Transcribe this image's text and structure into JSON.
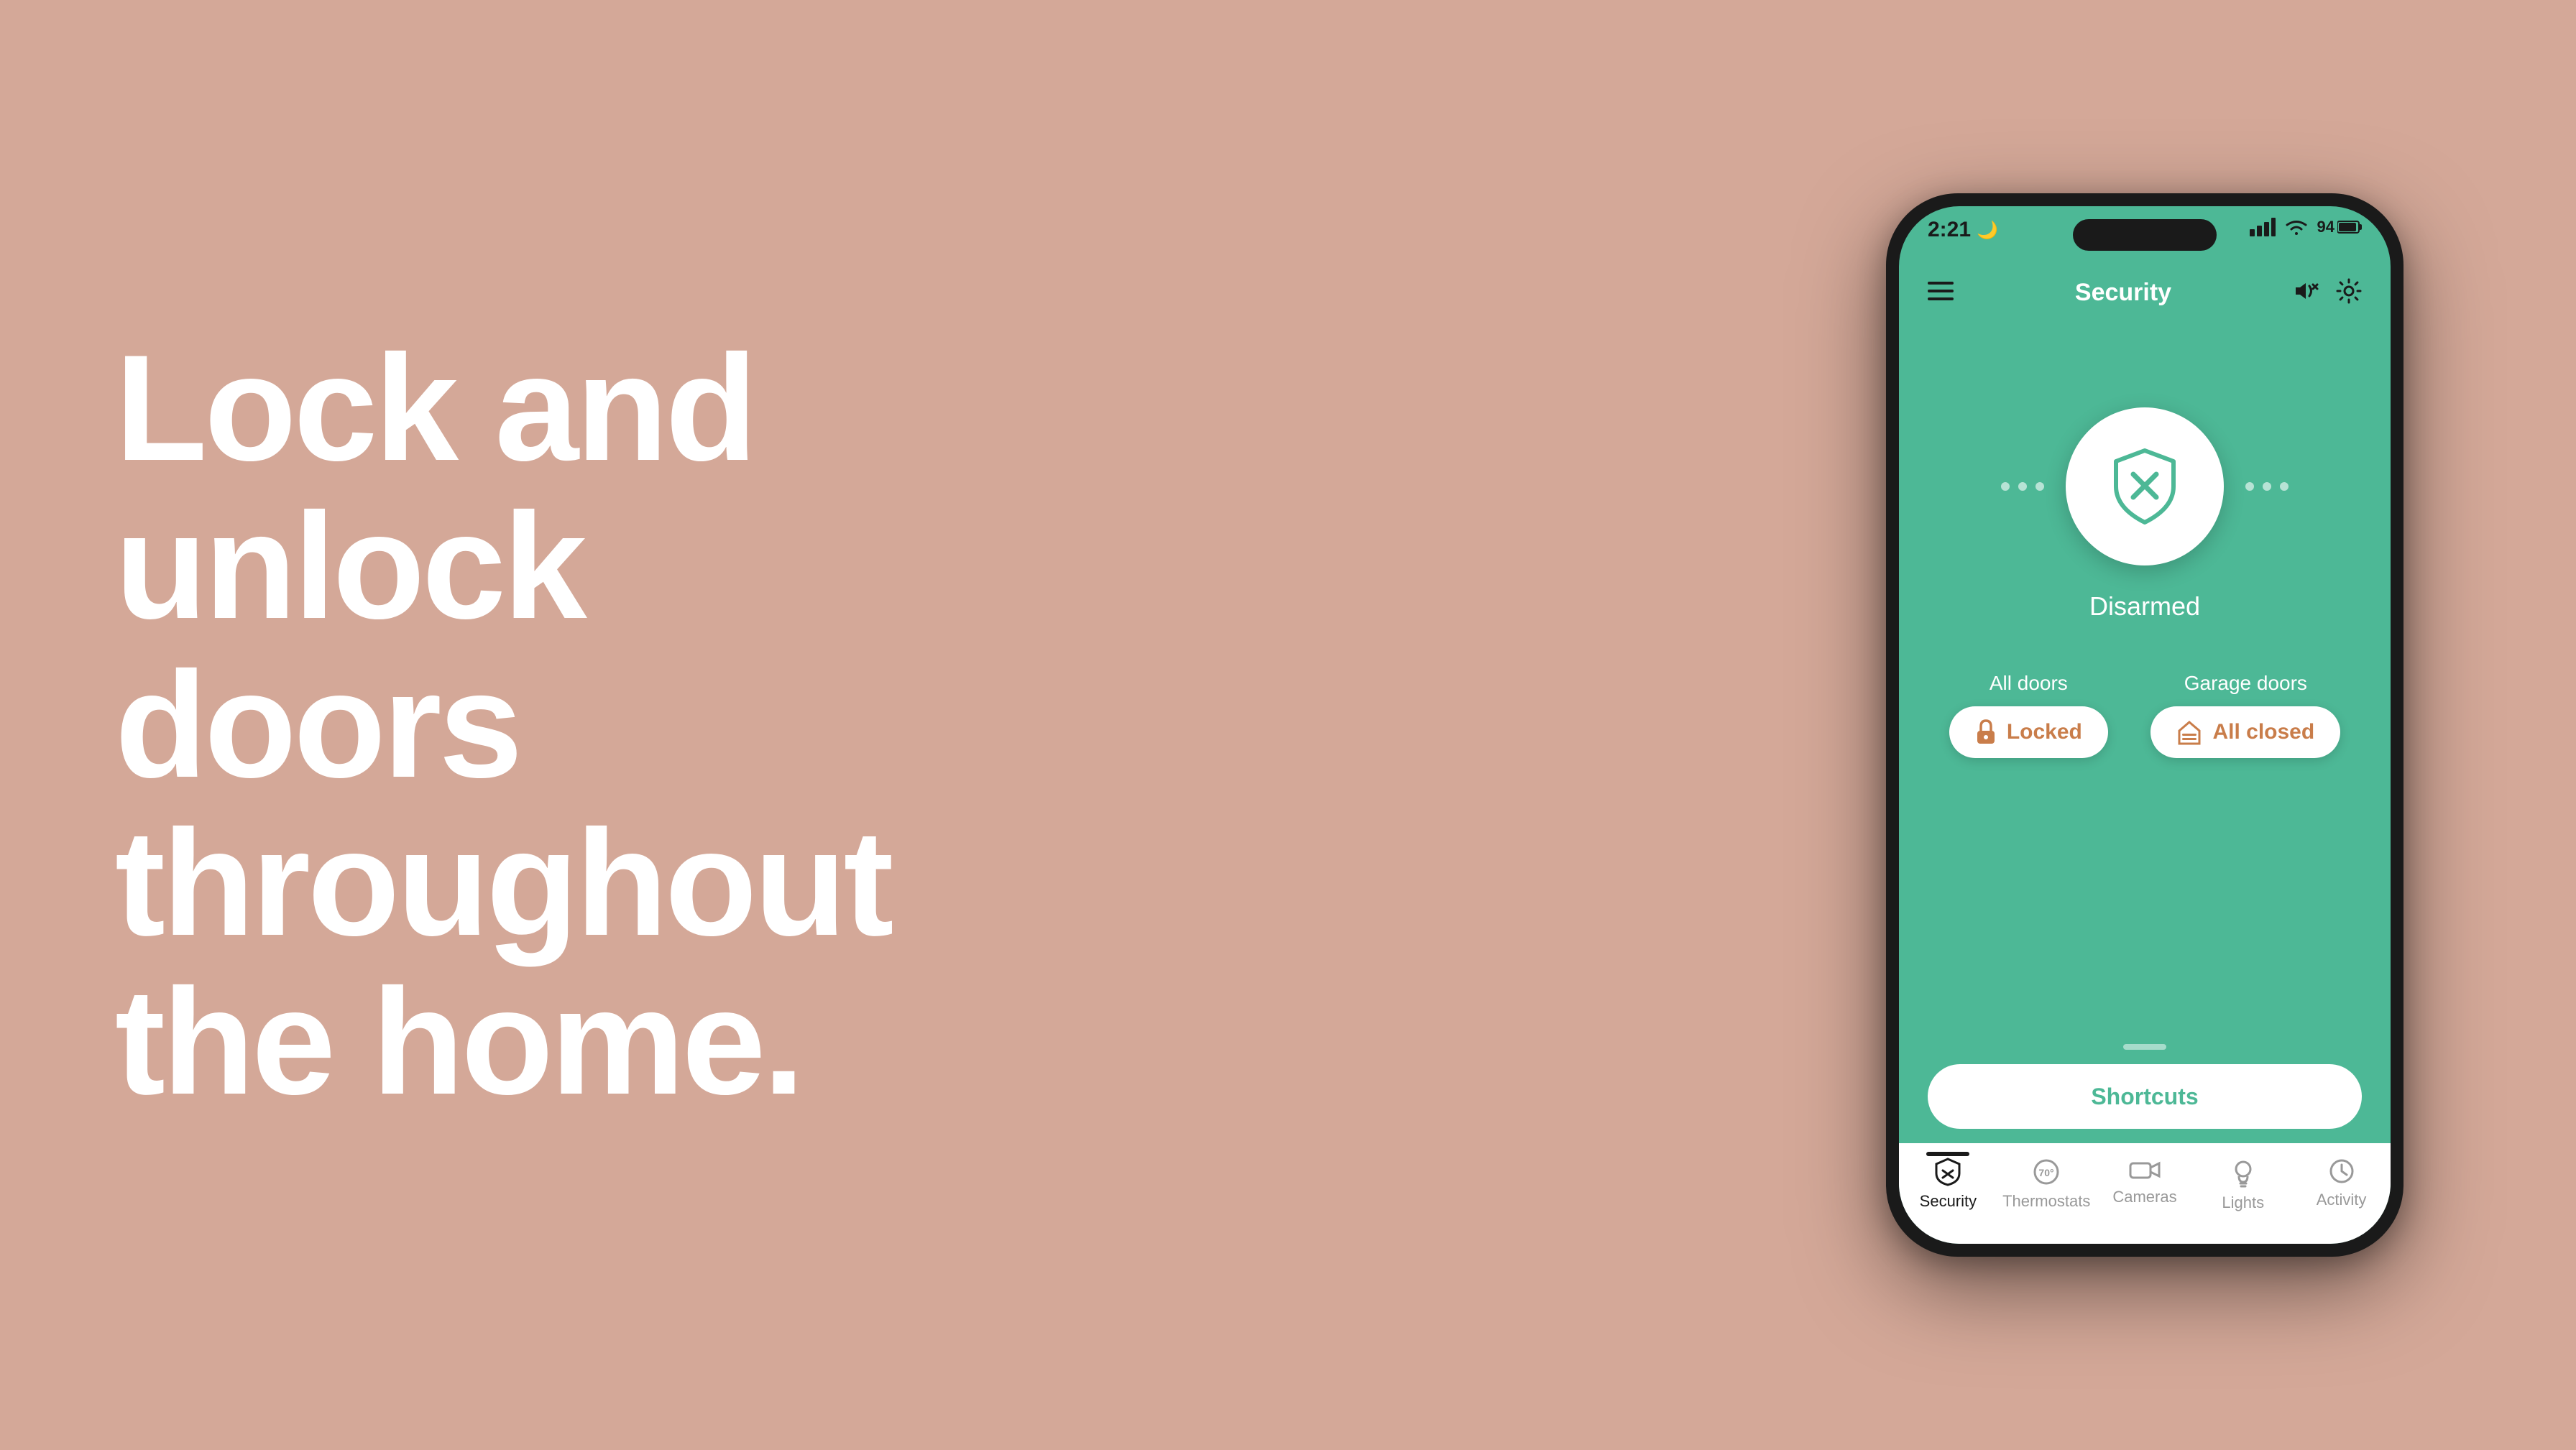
{
  "background": {
    "color": "#d4a898"
  },
  "headline": {
    "line1": "Lock and",
    "line2": "unlock",
    "line3": "doors",
    "line4": "throughout",
    "line5": "the home."
  },
  "status_bar": {
    "time": "2:21",
    "moon_symbol": "☽",
    "battery_percent": "94"
  },
  "app_header": {
    "menu_icon": "≡",
    "title": "Security",
    "volume_icon": "🔊",
    "settings_icon": "⚙"
  },
  "security": {
    "status": "Disarmed",
    "dots_left": [
      "•",
      "•",
      "•"
    ],
    "dots_right": [
      "•",
      "•",
      "•"
    ]
  },
  "doors": {
    "all_doors": {
      "label": "All doors",
      "status": "Locked"
    },
    "garage_doors": {
      "label": "Garage doors",
      "status": "All closed"
    }
  },
  "shortcuts": {
    "label": "Shortcuts"
  },
  "bottom_nav": {
    "items": [
      {
        "id": "security",
        "label": "Security",
        "active": true
      },
      {
        "id": "thermostats",
        "label": "Thermostats",
        "active": false
      },
      {
        "id": "cameras",
        "label": "Cameras",
        "active": false
      },
      {
        "id": "lights",
        "label": "Lights",
        "active": false
      },
      {
        "id": "activity",
        "label": "Activity",
        "active": false
      }
    ]
  },
  "colors": {
    "teal": "#4db896",
    "orange_accent": "#c97d4a",
    "dark": "#1a1a1a",
    "white": "#ffffff"
  }
}
